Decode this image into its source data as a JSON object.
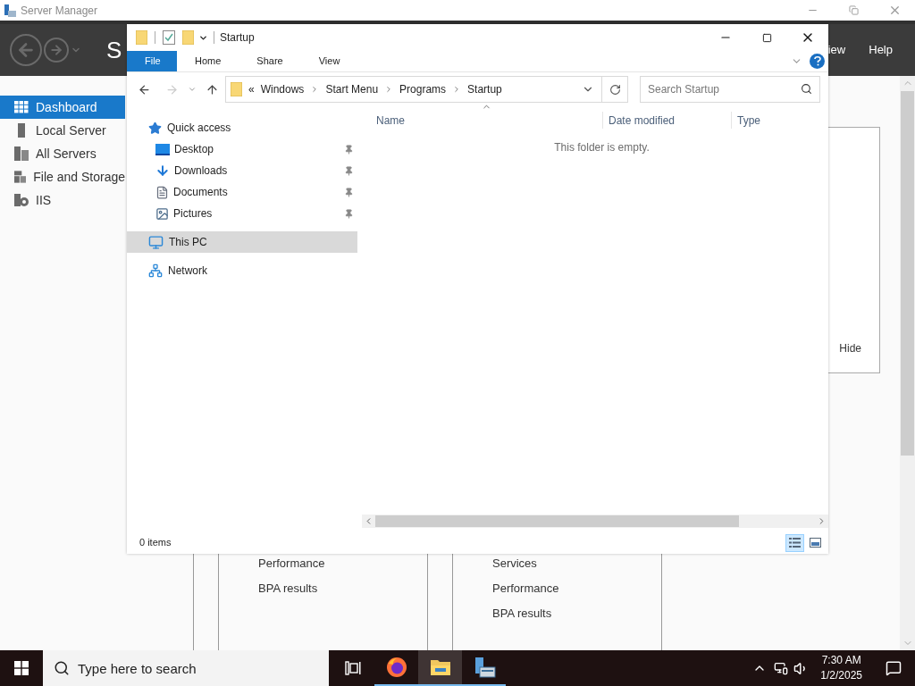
{
  "server_manager": {
    "title": "Server Manager",
    "header_title": "S",
    "menu": [
      "iew",
      "Help"
    ],
    "nav": [
      {
        "label": "Dashboard",
        "kind": "dashboard",
        "selected": true
      },
      {
        "label": "Local Server",
        "kind": "server",
        "selected": false
      },
      {
        "label": "All Servers",
        "kind": "servers",
        "selected": false
      },
      {
        "label": "File and Storage",
        "kind": "storage",
        "selected": false
      },
      {
        "label": "IIS",
        "kind": "iis",
        "selected": false
      }
    ],
    "hide_label": "Hide",
    "tiles": [
      {
        "items": [
          "Performance",
          "BPA results"
        ]
      },
      {
        "items": [
          "Services",
          "Performance",
          "BPA results"
        ]
      }
    ]
  },
  "explorer": {
    "title": "Startup",
    "ribbon_tabs": [
      {
        "label": "File",
        "selected": true
      },
      {
        "label": "Home",
        "selected": false
      },
      {
        "label": "Share",
        "selected": false
      },
      {
        "label": "View",
        "selected": false
      }
    ],
    "breadcrumb": {
      "overflow": "«",
      "parts": [
        "Windows",
        "Start Menu",
        "Programs",
        "Startup"
      ]
    },
    "search": {
      "placeholder": "Search Startup"
    },
    "nav_pane": [
      {
        "label": "Quick access",
        "kind": "quick-access",
        "selected": false,
        "children": [
          {
            "label": "Desktop",
            "kind": "desktop",
            "pinned": true,
            "selected": false
          },
          {
            "label": "Downloads",
            "kind": "downloads",
            "pinned": true,
            "selected": false
          },
          {
            "label": "Documents",
            "kind": "documents",
            "pinned": true,
            "selected": false
          },
          {
            "label": "Pictures",
            "kind": "pictures",
            "pinned": true,
            "selected": false
          }
        ]
      },
      {
        "label": "This PC",
        "kind": "pc",
        "selected": true
      },
      {
        "label": "Network",
        "kind": "network",
        "selected": false
      }
    ],
    "columns": [
      "Name",
      "Date modified",
      "Type"
    ],
    "empty_message": "This folder is empty.",
    "status": "0 items"
  },
  "taskbar": {
    "search_placeholder": "Type here to search",
    "apps": [
      {
        "kind": "task-view",
        "selected": false
      },
      {
        "kind": "firefox",
        "selected": false
      },
      {
        "kind": "explorer",
        "selected": true
      },
      {
        "kind": "server-manager",
        "selected": false
      }
    ],
    "time": "7:30 AM",
    "date": "1/2/2025"
  }
}
